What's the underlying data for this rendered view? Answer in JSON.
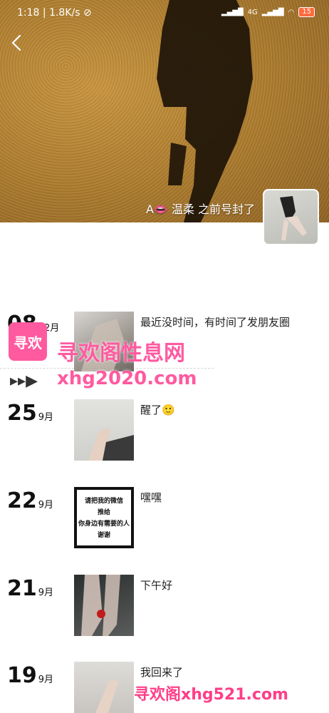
{
  "status_bar": {
    "time": "1:18",
    "speed": "1.8K/s",
    "signal": "4G",
    "battery": "15"
  },
  "profile": {
    "nickname": "A👄 温柔 之前号封了"
  },
  "posts": [
    {
      "day": "08",
      "month": "12月",
      "text": "最近没时间，有时间了发朋友圈"
    },
    {
      "day": "25",
      "month": "9月",
      "text": "醒了🙂"
    },
    {
      "day": "22",
      "month": "9月",
      "text": "嘿嘿"
    },
    {
      "day": "21",
      "month": "9月",
      "text": "下午好"
    },
    {
      "day": "19",
      "month": "9月",
      "text": "我回来了"
    }
  ],
  "image_card": {
    "lines": [
      "请把我的微信",
      "推给",
      "你身边有需要的人",
      "谢谢"
    ]
  },
  "watermarks": {
    "site_title": "寻欢阁性息网",
    "site_url": "xhg2020.com",
    "logo_text": "寻欢",
    "bottom": "寻欢阁xhg521.com"
  },
  "colors": {
    "accent": "#ff5aa0"
  }
}
